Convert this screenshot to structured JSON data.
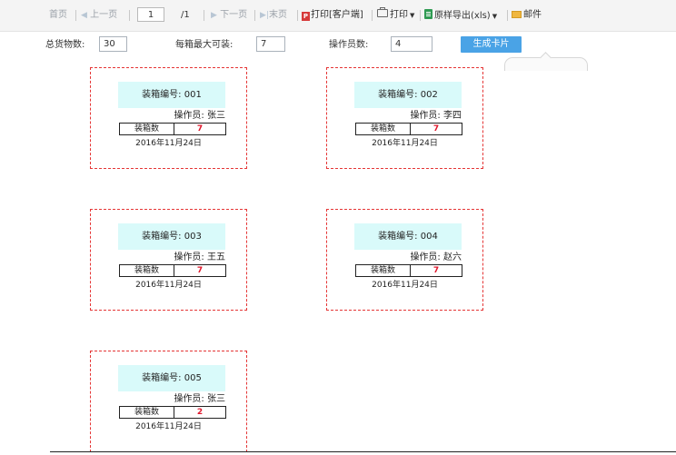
{
  "toolbar": {
    "first": "首页",
    "prev": "上一页",
    "page_value": "1",
    "page_total": "/1",
    "next": "下一页",
    "last": "末页",
    "print_client": "打印[客户端]",
    "print": "打印",
    "export_excel": "原样导出(xls)",
    "mail": "邮件"
  },
  "form": {
    "total_label": "总货物数:",
    "total_value": "30",
    "max_label": "每箱最大可装:",
    "max_value": "7",
    "operators_label": "操作员数:",
    "operators_value": "4",
    "generate_button": "生成卡片"
  },
  "cards": [
    {
      "box": "装箱编号: 001",
      "operator": "操作员: 张三",
      "count_label": "装箱数",
      "count": "7",
      "date": "2016年11月24日"
    },
    {
      "box": "装箱编号: 002",
      "operator": "操作员: 李四",
      "count_label": "装箱数",
      "count": "7",
      "date": "2016年11月24日"
    },
    {
      "box": "装箱编号: 003",
      "operator": "操作员: 王五",
      "count_label": "装箱数",
      "count": "7",
      "date": "2016年11月24日"
    },
    {
      "box": "装箱编号: 004",
      "operator": "操作员: 赵六",
      "count_label": "装箱数",
      "count": "7",
      "date": "2016年11月24日"
    },
    {
      "box": "装箱编号: 005",
      "operator": "操作员: 张三",
      "count_label": "装箱数",
      "count": "2",
      "date": "2016年11月24日"
    }
  ],
  "colors": {
    "card_border": "#e53535",
    "card_header_bg": "#d9fafa",
    "count_text": "#e0182d",
    "button_bg": "#4aa3e6"
  },
  "icons": [
    "arrow-left-icon",
    "arrow-right-icon",
    "pdf-icon",
    "printer-icon",
    "excel-icon",
    "mail-icon"
  ]
}
